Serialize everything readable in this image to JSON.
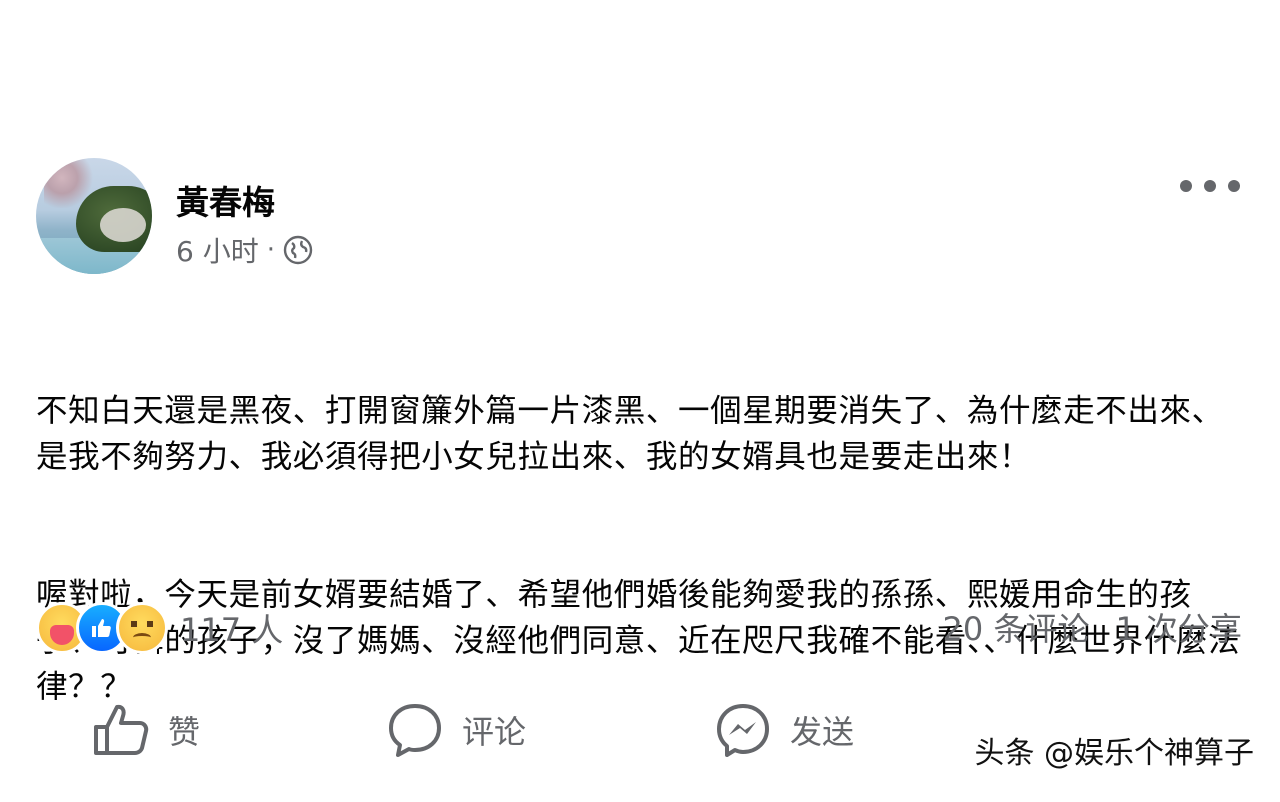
{
  "post": {
    "author": "黃春梅",
    "time": "6 小时",
    "separator": "·",
    "paragraphs": [
      "不知白天還是黑夜、打開窗簾外篇一片漆黑、一個星期要消失了、為什麼走不出來、是我不夠努力、我必須得把小女兒拉出來、我的女婿具也是要走出來！",
      "喔對啦，今天是前女婿要結婚了、希望他們婚後能夠愛我的孫孫、熙媛用命生的孩子、可憐的孩子，沒了媽媽、沒經他們同意、近在咫尺我確不能看、、什麼世界什麼法律？？"
    ]
  },
  "reactions": {
    "icons": [
      "care-reaction-icon",
      "like-reaction-icon",
      "sad-reaction-icon"
    ],
    "count": "117 人"
  },
  "stats": {
    "comments": "20 条评论",
    "shares": "1 次分享"
  },
  "actions": {
    "like_label": "赞",
    "comment_label": "评论",
    "send_label": "发送"
  },
  "watermark": "头条 @娱乐个神算子"
}
